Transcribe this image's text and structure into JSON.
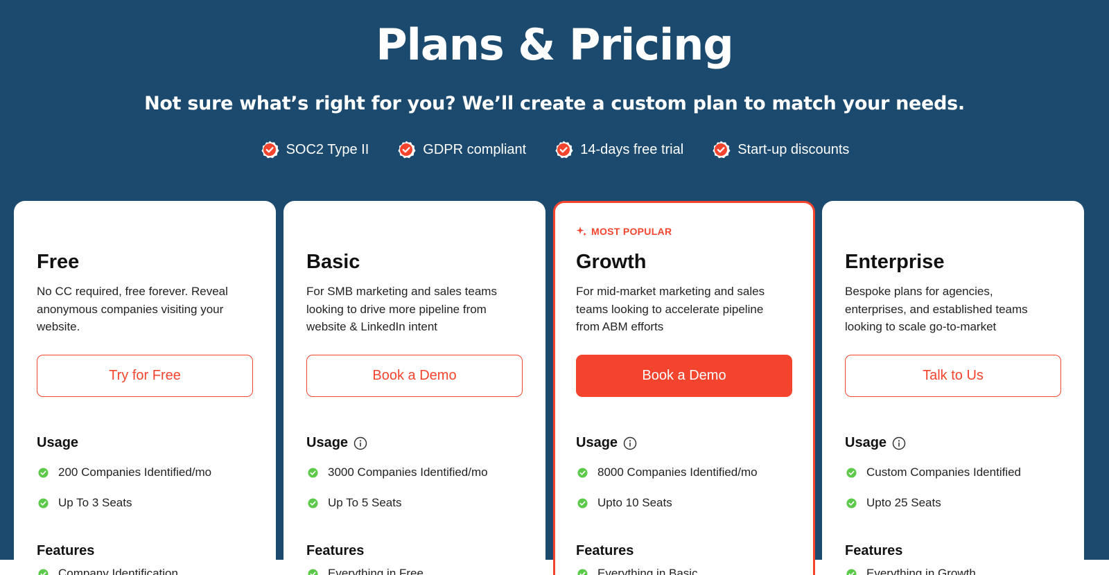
{
  "header": {
    "title": "Plans & Pricing",
    "subtitle": "Not sure what’s right for you? We’ll create a custom plan to match your needs."
  },
  "badges": [
    {
      "label": "SOC2 Type II",
      "icon": "verified-badge-icon"
    },
    {
      "label": "GDPR compliant",
      "icon": "verified-badge-icon"
    },
    {
      "label": "14-days free trial",
      "icon": "verified-badge-icon"
    },
    {
      "label": "Start-up discounts",
      "icon": "verified-badge-icon"
    }
  ],
  "colors": {
    "hero_bg": "#1b4a6e",
    "accent": "#f4442e",
    "check": "#5cc94a"
  },
  "plans": [
    {
      "name": "Free",
      "tag": "",
      "description": "No CC required, free forever. Reveal anonymous companies visiting your website.",
      "cta": "Try for Free",
      "usage_title": "Usage",
      "usage": [
        "200 Companies Identified/mo",
        "Up To 3 Seats"
      ],
      "features_title": "Features",
      "first_feature": "Company Identification"
    },
    {
      "name": "Basic",
      "tag": "",
      "description": "For SMB marketing and sales teams looking to drive more pipeline from website & LinkedIn intent",
      "cta": "Book a Demo",
      "usage_title": "Usage",
      "usage": [
        "3000 Companies Identified/mo",
        "Up To 5 Seats"
      ],
      "features_title": "Features",
      "first_feature": "Everything in Free"
    },
    {
      "name": "Growth",
      "tag": "MOST POPULAR",
      "description": "For mid-market marketing and sales teams looking to accelerate pipeline from ABM efforts",
      "cta": "Book a Demo",
      "usage_title": "Usage",
      "usage": [
        "8000 Companies Identified/mo",
        "Upto 10 Seats"
      ],
      "features_title": "Features",
      "first_feature": "Everything in Basic"
    },
    {
      "name": "Enterprise",
      "tag": "",
      "description": "Bespoke plans for agencies, enterprises, and established teams looking to scale go-to-market",
      "cta": "Talk to Us",
      "usage_title": "Usage",
      "usage": [
        "Custom Companies Identified",
        "Upto 25 Seats"
      ],
      "features_title": "Features",
      "first_feature": "Everything in Growth"
    }
  ]
}
